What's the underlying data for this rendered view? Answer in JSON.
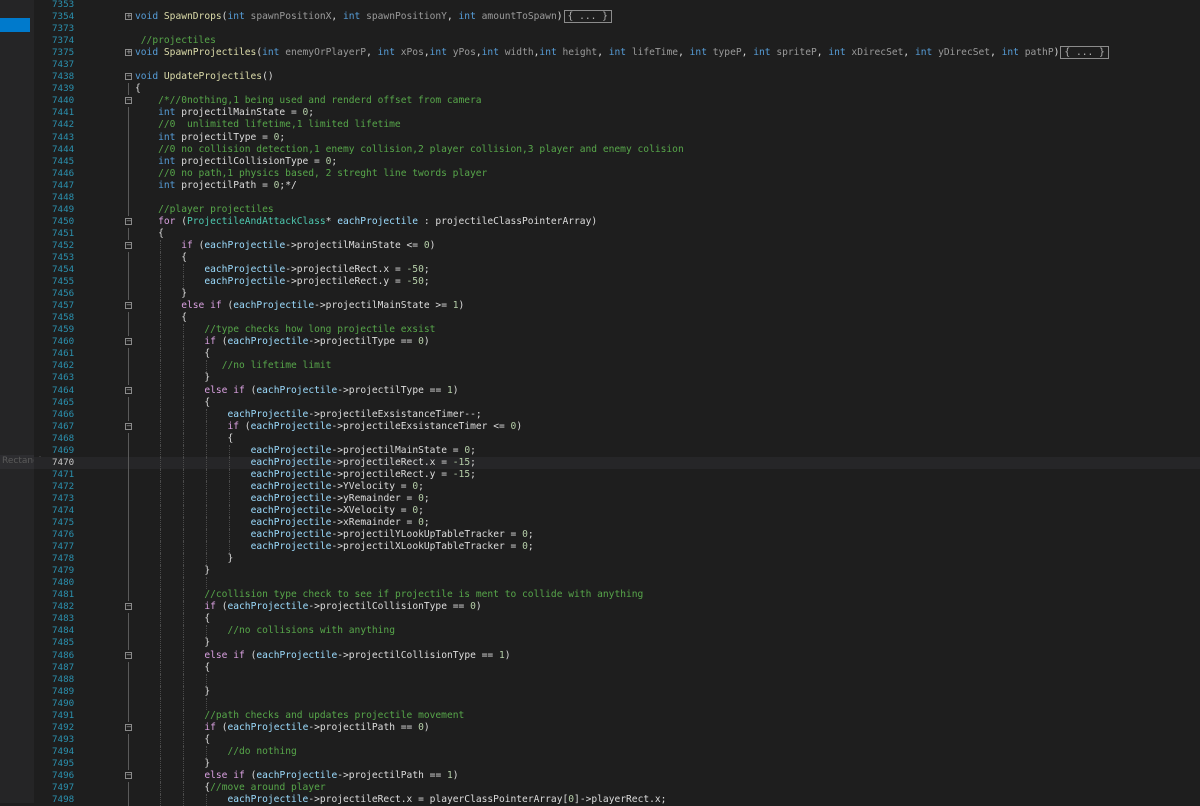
{
  "editor": {
    "language": "cpp",
    "left_panel_label": "Rectangle",
    "current_line": "7470",
    "lines": [
      {
        "n": "7353",
        "t": ""
      },
      {
        "n": "7354",
        "t": "void SpawnDrops(int spawnPositionX, int spawnPositionY, int amountToSpawn) { ... }",
        "fold": "plus"
      },
      {
        "n": "7373",
        "t": ""
      },
      {
        "n": "7374",
        "t": "//projectiles",
        "indent": 1
      },
      {
        "n": "7375",
        "t": "void SpawnProjectiles(int enemyOrPlayerP, int xPos,int yPos,int width,int height, int lifeTime, int typeP, int spriteP, int xDirecSet, int yDirecSet, int pathP) { ... }",
        "fold": "plus"
      },
      {
        "n": "7437",
        "t": ""
      },
      {
        "n": "7438",
        "t": "void UpdateProjectiles()",
        "fold": "minus"
      },
      {
        "n": "7439",
        "t": "{"
      },
      {
        "n": "7440",
        "t": "/*//0nothing,1 being used and renderd offset from camera",
        "indent": 4,
        "fold": "minus"
      },
      {
        "n": "7441",
        "t": "int projectilMainState = 0;",
        "indent": 4
      },
      {
        "n": "7442",
        "t": "//0  unlimited lifetime,1 limited lifetime",
        "indent": 4
      },
      {
        "n": "7443",
        "t": "int projectilType = 0;",
        "indent": 4
      },
      {
        "n": "7444",
        "t": "//0 no collision detection,1 enemy collision,2 player collision,3 player and enemy colision",
        "indent": 4
      },
      {
        "n": "7445",
        "t": "int projectilCollisionType = 0;",
        "indent": 4
      },
      {
        "n": "7446",
        "t": "//0 no path,1 physics based, 2 streght line twords player",
        "indent": 4
      },
      {
        "n": "7447",
        "t": "int projectilPath = 0;*/",
        "indent": 4
      },
      {
        "n": "7448",
        "t": ""
      },
      {
        "n": "7449",
        "t": "//player projectiles",
        "indent": 4
      },
      {
        "n": "7450",
        "t": "for (ProjectileAndAttackClass* eachProjectile : projectileClassPointerArray)",
        "indent": 4,
        "fold": "minus"
      },
      {
        "n": "7451",
        "t": "{",
        "indent": 4
      },
      {
        "n": "7452",
        "t": "if (eachProjectile->projectilMainState <= 0)",
        "indent": 8,
        "fold": "minus"
      },
      {
        "n": "7453",
        "t": "{",
        "indent": 8
      },
      {
        "n": "7454",
        "t": "eachProjectile->projectileRect.x = -50;",
        "indent": 12
      },
      {
        "n": "7455",
        "t": "eachProjectile->projectileRect.y = -50;",
        "indent": 12
      },
      {
        "n": "7456",
        "t": "}",
        "indent": 8
      },
      {
        "n": "7457",
        "t": "else if (eachProjectile->projectilMainState >= 1)",
        "indent": 8,
        "fold": "minus"
      },
      {
        "n": "7458",
        "t": "{",
        "indent": 8
      },
      {
        "n": "7459",
        "t": "//type checks how long projectile exsist",
        "indent": 12
      },
      {
        "n": "7460",
        "t": "if (eachProjectile->projectilType == 0)",
        "indent": 12,
        "fold": "minus"
      },
      {
        "n": "7461",
        "t": "{",
        "indent": 12
      },
      {
        "n": "7462",
        "t": "//no lifetime limit",
        "indent": 15
      },
      {
        "n": "7463",
        "t": "}",
        "indent": 12
      },
      {
        "n": "7464",
        "t": "else if (eachProjectile->projectilType == 1)",
        "indent": 12,
        "fold": "minus"
      },
      {
        "n": "7465",
        "t": "{",
        "indent": 12
      },
      {
        "n": "7466",
        "t": "eachProjectile->projectileExsistanceTimer--;",
        "indent": 16
      },
      {
        "n": "7467",
        "t": "if (eachProjectile->projectileExsistanceTimer <= 0)",
        "indent": 16,
        "fold": "minus"
      },
      {
        "n": "7468",
        "t": "{",
        "indent": 16
      },
      {
        "n": "7469",
        "t": "eachProjectile->projectilMainState = 0;",
        "indent": 20
      },
      {
        "n": "7470",
        "t": "eachProjectile->projectileRect.x = -15;",
        "indent": 20
      },
      {
        "n": "7471",
        "t": "eachProjectile->projectileRect.y = -15;",
        "indent": 20
      },
      {
        "n": "7472",
        "t": "eachProjectile->YVelocity = 0;",
        "indent": 20
      },
      {
        "n": "7473",
        "t": "eachProjectile->yRemainder = 0;",
        "indent": 20
      },
      {
        "n": "7474",
        "t": "eachProjectile->XVelocity = 0;",
        "indent": 20
      },
      {
        "n": "7475",
        "t": "eachProjectile->xRemainder = 0;",
        "indent": 20
      },
      {
        "n": "7476",
        "t": "eachProjectile->projectilYLookUpTableTracker = 0;",
        "indent": 20
      },
      {
        "n": "7477",
        "t": "eachProjectile->projectilXLookUpTableTracker = 0;",
        "indent": 20
      },
      {
        "n": "7478",
        "t": "}",
        "indent": 16
      },
      {
        "n": "7479",
        "t": "}",
        "indent": 12
      },
      {
        "n": "7480",
        "t": ""
      },
      {
        "n": "7481",
        "t": "//collision type check to see if projectile is ment to collide with anything",
        "indent": 12
      },
      {
        "n": "7482",
        "t": "if (eachProjectile->projectilCollisionType == 0)",
        "indent": 12,
        "fold": "minus"
      },
      {
        "n": "7483",
        "t": "{",
        "indent": 12
      },
      {
        "n": "7484",
        "t": "//no collisions with anything",
        "indent": 16
      },
      {
        "n": "7485",
        "t": "}",
        "indent": 12
      },
      {
        "n": "7486",
        "t": "else if (eachProjectile->projectilCollisionType == 1)",
        "indent": 12,
        "fold": "minus"
      },
      {
        "n": "7487",
        "t": "{",
        "indent": 12
      },
      {
        "n": "7488",
        "t": ""
      },
      {
        "n": "7489",
        "t": "}",
        "indent": 12
      },
      {
        "n": "7490",
        "t": ""
      },
      {
        "n": "7491",
        "t": "//path checks and updates projectile movement",
        "indent": 12
      },
      {
        "n": "7492",
        "t": "if (eachProjectile->projectilPath == 0)",
        "indent": 12,
        "fold": "minus"
      },
      {
        "n": "7493",
        "t": "{",
        "indent": 12
      },
      {
        "n": "7494",
        "t": "//do nothing",
        "indent": 16
      },
      {
        "n": "7495",
        "t": "}",
        "indent": 12
      },
      {
        "n": "7496",
        "t": "else if (eachProjectile->projectilPath == 1)",
        "indent": 12,
        "fold": "minus"
      },
      {
        "n": "7497",
        "t": "{//move around player",
        "indent": 12
      },
      {
        "n": "7498",
        "t": "eachProjectile->projectileRect.x = playerClassPointerArray[0]->playerRect.x;",
        "indent": 16
      }
    ]
  }
}
